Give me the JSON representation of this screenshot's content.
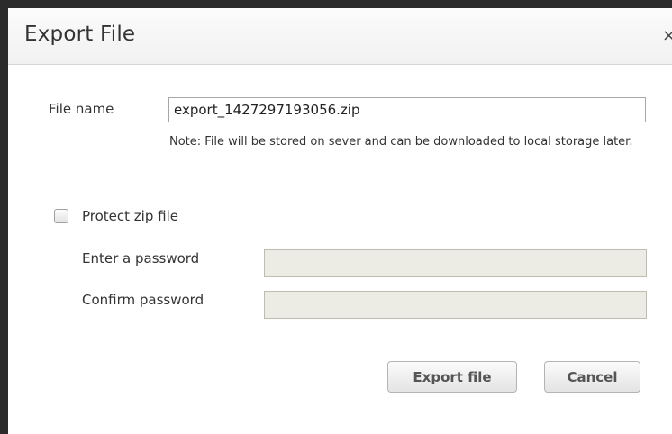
{
  "dialog": {
    "title": "Export File",
    "close_glyph": "×"
  },
  "file_name": {
    "label": "File name",
    "value": "export_1427297193056.zip",
    "note": "Note: File will be stored on sever and can be downloaded to local storage later."
  },
  "protect": {
    "label": "Protect zip file",
    "checked": false
  },
  "password": {
    "enter_label": "Enter a password",
    "confirm_label": "Confirm password",
    "enter_value": "",
    "confirm_value": "",
    "disabled": true
  },
  "buttons": {
    "export": "Export file",
    "cancel": "Cancel"
  }
}
